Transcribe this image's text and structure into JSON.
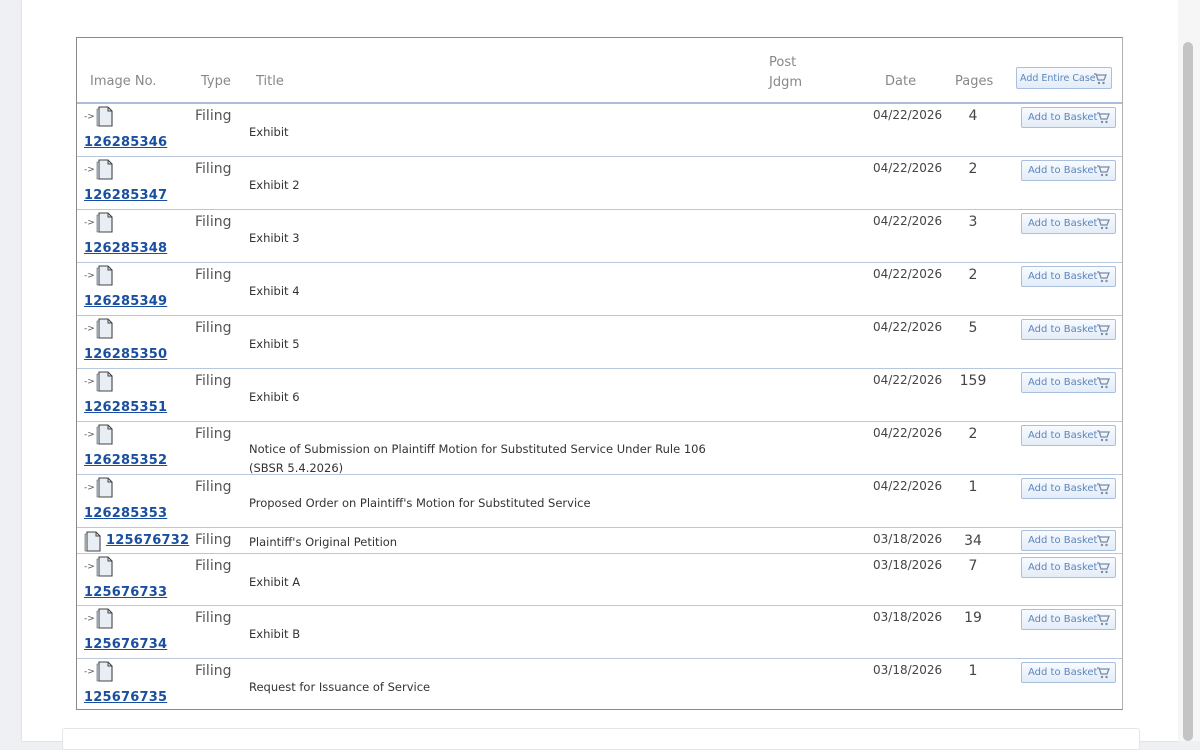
{
  "headers": {
    "image_no": "Image No.",
    "type": "Type",
    "title": "Title",
    "post_jdgm": "Post Jdgm",
    "date": "Date",
    "pages": "Pages",
    "add_entire_case": "Add Entire Case"
  },
  "row_arrow": "->",
  "add_to_basket_label": "Add to Basket",
  "rows": [
    {
      "image_no": "126285346",
      "type": "Filing",
      "title": "Exhibit",
      "date": "04/22/2026",
      "pages": "4"
    },
    {
      "image_no": "126285347",
      "type": "Filing",
      "title": "Exhibit 2",
      "date": "04/22/2026",
      "pages": "2"
    },
    {
      "image_no": "126285348",
      "type": "Filing",
      "title": "Exhibit 3",
      "date": "04/22/2026",
      "pages": "3"
    },
    {
      "image_no": "126285349",
      "type": "Filing",
      "title": "Exhibit 4",
      "date": "04/22/2026",
      "pages": "2"
    },
    {
      "image_no": "126285350",
      "type": "Filing",
      "title": "Exhibit 5",
      "date": "04/22/2026",
      "pages": "5"
    },
    {
      "image_no": "126285351",
      "type": "Filing",
      "title": "Exhibit 6",
      "date": "04/22/2026",
      "pages": "159"
    },
    {
      "image_no": "126285352",
      "type": "Filing",
      "title": "Notice of Submission on Plaintiff Motion for Substituted Service Under Rule 106 (SBSR 5.4.2026)",
      "date": "04/22/2026",
      "pages": "2"
    },
    {
      "image_no": "126285353",
      "type": "Filing",
      "title": "Proposed Order on Plaintiff's Motion for Substituted Service",
      "date": "04/22/2026",
      "pages": "1"
    },
    {
      "image_no": "125676732",
      "type": "Filing",
      "title": "Plaintiff's Original Petition",
      "date": "03/18/2026",
      "pages": "34"
    },
    {
      "image_no": "125676733",
      "type": "Filing",
      "title": "Exhibit A",
      "date": "03/18/2026",
      "pages": "7"
    },
    {
      "image_no": "125676734",
      "type": "Filing",
      "title": "Exhibit B",
      "date": "03/18/2026",
      "pages": "19"
    },
    {
      "image_no": "125676735",
      "type": "Filing",
      "title": "Request for Issuance of Service",
      "date": "03/18/2026",
      "pages": "1"
    }
  ]
}
